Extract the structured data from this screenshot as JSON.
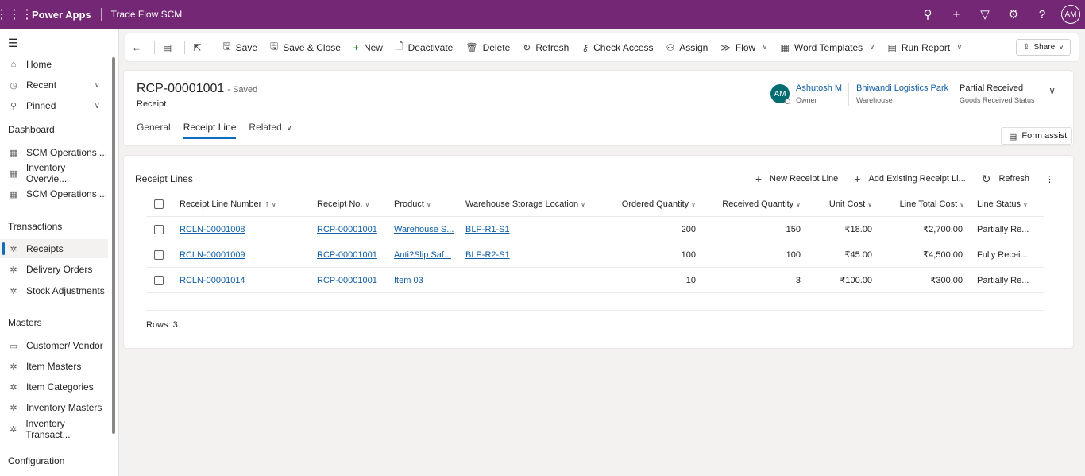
{
  "topbar": {
    "brand": "Power Apps",
    "app_name": "Trade Flow SCM",
    "avatar": "AM",
    "icons": [
      "waffle-icon",
      "search-icon",
      "plus-icon",
      "filter-icon",
      "gear-icon",
      "help-icon"
    ]
  },
  "sidebar": {
    "items": [
      {
        "label": "Home",
        "icon": "home-icon"
      },
      {
        "label": "Recent",
        "icon": "clock-icon"
      },
      {
        "label": "Pinned",
        "icon": "pin-icon"
      }
    ],
    "groups": [
      {
        "title": "Dashboard",
        "items": [
          "SCM Operations ...",
          "Inventory Overvie...",
          "SCM Operations ..."
        ]
      },
      {
        "title": "Transactions",
        "items": [
          "Receipts",
          "Delivery Orders",
          "Stock Adjustments"
        ]
      },
      {
        "title": "Masters",
        "items": [
          "Customer/ Vendor",
          "Item Masters",
          "Item Categories",
          "Inventory Masters",
          "Inventory Transact..."
        ]
      },
      {
        "title": "Configuration",
        "items": []
      }
    ],
    "active_item": "Receipts"
  },
  "commandbar": {
    "save": "Save",
    "save_close": "Save & Close",
    "new": "New",
    "deactivate": "Deactivate",
    "delete": "Delete",
    "refresh": "Refresh",
    "check_access": "Check Access",
    "assign": "Assign",
    "flow": "Flow",
    "word_templates": "Word Templates",
    "run_report": "Run Report",
    "share": "Share"
  },
  "record": {
    "title": "RCP-00001001",
    "saved": "- Saved",
    "type": "Receipt",
    "tabs": [
      "General",
      "Receipt Line",
      "Related"
    ],
    "active_tab": "Receipt Line",
    "owner_initials": "AM",
    "owner_name": "Ashutosh M",
    "owner_label": "Owner",
    "warehouse_name": "Bhiwandi Logistics Park",
    "warehouse_label": "Warehouse",
    "status_value": "Partial Received",
    "status_label": "Goods Received Status",
    "form_assist": "Form assist"
  },
  "grid": {
    "title": "Receipt Lines",
    "actions": {
      "new_line": "New Receipt Line",
      "add_existing": "Add Existing Receipt Li...",
      "refresh": "Refresh"
    },
    "columns": [
      "Receipt Line Number",
      "Receipt No.",
      "Product",
      "Warehouse Storage Location",
      "Ordered Quantity",
      "Received Quantity",
      "Unit Cost",
      "Line Total Cost",
      "Line Status"
    ],
    "rows": [
      {
        "line": "RCLN-00001008",
        "receipt": "RCP-00001001",
        "product": "Warehouse S...",
        "location": "BLP-R1-S1",
        "ordered": "200",
        "received": "150",
        "unit_cost": "₹18.00",
        "total": "₹2,700.00",
        "status": "Partially Re..."
      },
      {
        "line": "RCLN-00001009",
        "receipt": "RCP-00001001",
        "product": "Anti?Slip Saf...",
        "location": "BLP-R2-S1",
        "ordered": "100",
        "received": "100",
        "unit_cost": "₹45.00",
        "total": "₹4,500.00",
        "status": "Fully Recei..."
      },
      {
        "line": "RCLN-00001014",
        "receipt": "RCP-00001001",
        "product": "Item 03",
        "location": "",
        "ordered": "10",
        "received": "3",
        "unit_cost": "₹100.00",
        "total": "₹300.00",
        "status": "Partially Re..."
      }
    ],
    "rows_count": "Rows: 3"
  },
  "colors": {
    "topbar": "#742774",
    "link": "#115ea3",
    "accent": "#0f6cbd",
    "avatar": "#036c70"
  }
}
